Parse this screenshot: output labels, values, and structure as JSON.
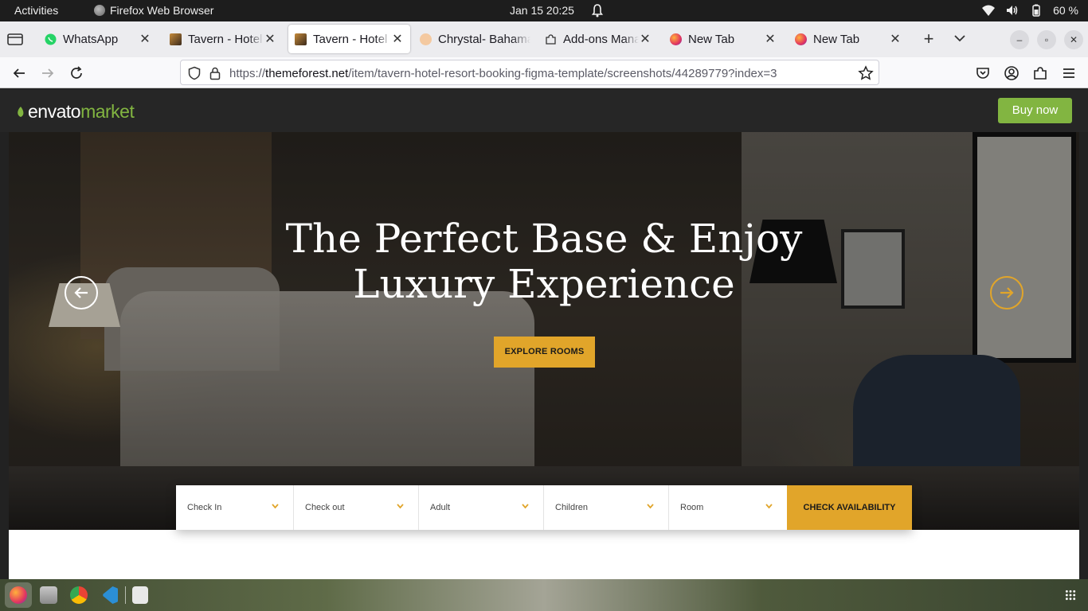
{
  "system": {
    "activities": "Activities",
    "app_name": "Firefox Web Browser",
    "clock": "Jan 15  20:25",
    "battery": "60 %"
  },
  "tabs": [
    {
      "title": "WhatsApp",
      "icon": "whatsapp-icon",
      "active": false
    },
    {
      "title": "Tavern - Hotel & R",
      "icon": "tavern-icon",
      "active": false
    },
    {
      "title": "Tavern - Hotel & R",
      "icon": "tavern-icon",
      "active": true
    },
    {
      "title": "Chrystal- Bahamas",
      "icon": "chrystal-icon",
      "active": false
    },
    {
      "title": "Add-ons Manager",
      "icon": "puzzle-icon",
      "active": false
    },
    {
      "title": "New Tab",
      "icon": "firefox-icon",
      "active": false
    },
    {
      "title": "New Tab",
      "icon": "firefox-icon",
      "active": false
    }
  ],
  "navbar": {
    "url_prefix": "https://",
    "url_domain": "themeforest.net",
    "url_path": "/item/tavern-hotel-resort-booking-figma-template/screenshots/44289779?index=3"
  },
  "envato": {
    "logo_envato": "envato",
    "logo_market": "market",
    "buy_label": "Buy now"
  },
  "hero": {
    "heading_line1": "The Perfect Base & Enjoy",
    "heading_line2": "Luxury Experience",
    "cta_label": "EXPLORE ROOMS"
  },
  "booking": {
    "fields": [
      "Check In",
      "Check out",
      "Adult",
      "Children",
      "Room"
    ],
    "submit_label": "CHECK AVAILABILITY"
  },
  "colors": {
    "accent_gold": "#e1a52a",
    "envato_green": "#82b541",
    "header_dark": "#262626"
  }
}
